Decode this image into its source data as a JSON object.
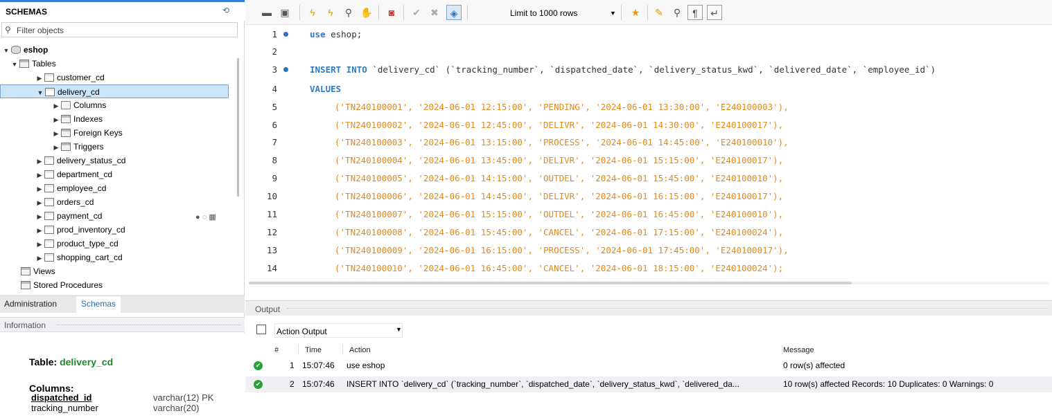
{
  "sidebar": {
    "header": "SCHEMAS",
    "filter_placeholder": "Filter objects",
    "tree": {
      "schema": "eshop",
      "tables_label": "Tables",
      "tables": [
        "customer_cd",
        "delivery_cd",
        "delivery_status_cd",
        "department_cd",
        "employee_cd",
        "orders_cd",
        "payment_cd",
        "prod_inventory_cd",
        "product_type_cd",
        "shopping_cart_cd"
      ],
      "selected_table": "delivery_cd",
      "subnodes": [
        "Columns",
        "Indexes",
        "Foreign Keys",
        "Triggers"
      ],
      "views_label": "Views",
      "procs_label": "Stored Procedures"
    },
    "tabs": {
      "admin": "Administration",
      "schemas": "Schemas"
    },
    "info": {
      "header": "Information",
      "table_label": "Table:",
      "table_name": "delivery_cd",
      "columns_label": "Columns:",
      "columns": [
        {
          "name": "dispatched_id",
          "type": "varchar(12) PK"
        },
        {
          "name": "tracking_number",
          "type": "varchar(20)"
        }
      ]
    }
  },
  "toolbar": {
    "limit_label": "Limit to 1000 rows"
  },
  "editor": {
    "lines": [
      {
        "n": "1",
        "dot": true
      },
      {
        "n": "2",
        "dot": false
      },
      {
        "n": "3",
        "dot": true
      },
      {
        "n": "4",
        "dot": false
      },
      {
        "n": "5"
      },
      {
        "n": "6"
      },
      {
        "n": "7"
      },
      {
        "n": "8"
      },
      {
        "n": "9"
      },
      {
        "n": "10"
      },
      {
        "n": "11"
      },
      {
        "n": "12"
      },
      {
        "n": "13"
      },
      {
        "n": "14"
      }
    ],
    "line1_kw": "use",
    "line1_rest": " eshop;",
    "line3_kw": "INSERT INTO",
    "line3_rest": " `delivery_cd` (`tracking_number`, `dispatched_date`, `delivery_status_kwd`, `delivered_date`, `employee_id`)",
    "line4_kw": "VALUES",
    "rows": [
      "('TN240100001', '2024-06-01 12:15:00', 'PENDING', '2024-06-01 13:30:00', 'E240100003'),",
      "('TN240100002', '2024-06-01 12:45:00', 'DELIVR', '2024-06-01 14:30:00', 'E240100017'),",
      "('TN240100003', '2024-06-01 13:15:00', 'PROCESS', '2024-06-01 14:45:00', 'E240100010'),",
      "('TN240100004', '2024-06-01 13:45:00', 'DELIVR', '2024-06-01 15:15:00', 'E240100017'),",
      "('TN240100005', '2024-06-01 14:15:00', 'OUTDEL', '2024-06-01 15:45:00', 'E240100010'),",
      "('TN240100006', '2024-06-01 14:45:00', 'DELIVR', '2024-06-01 16:15:00', 'E240100017'),",
      "('TN240100007', '2024-06-01 15:15:00', 'OUTDEL', '2024-06-01 16:45:00', 'E240100010'),",
      "('TN240100008', '2024-06-01 15:45:00', 'CANCEL', '2024-06-01 17:15:00', 'E240100024'),",
      "('TN240100009', '2024-06-01 16:15:00', 'PROCESS', '2024-06-01 17:45:00', 'E240100017'),",
      "('TN240100010', '2024-06-01 16:45:00', 'CANCEL', '2024-06-01 18:15:00', 'E240100024');"
    ]
  },
  "output": {
    "header": "Output",
    "selector": "Action Output",
    "columns": {
      "num": "#",
      "time": "Time",
      "action": "Action",
      "message": "Message"
    },
    "rows": [
      {
        "num": "1",
        "time": "15:07:46",
        "action": "use eshop",
        "message": "0 row(s) affected"
      },
      {
        "num": "2",
        "time": "15:07:46",
        "action": "INSERT INTO `delivery_cd` (`tracking_number`, `dispatched_date`, `delivery_status_kwd`, `delivered_da...",
        "message": "10 row(s) affected Records: 10  Duplicates: 0  Warnings: 0"
      }
    ]
  }
}
